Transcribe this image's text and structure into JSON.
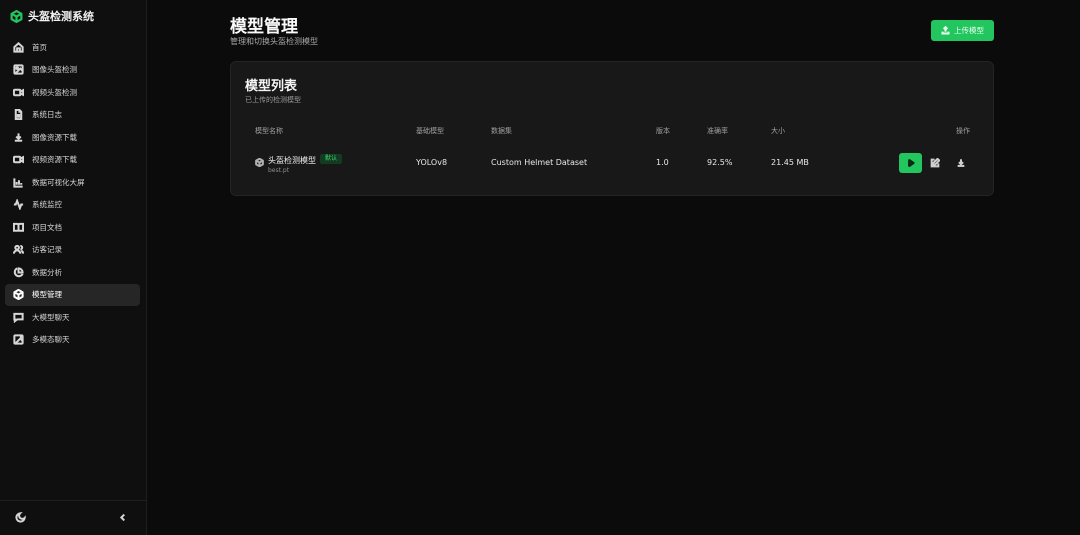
{
  "app": {
    "title": "头盔检测系统",
    "accent_color": "#22c55e"
  },
  "sidebar": {
    "items": [
      {
        "label": "首页",
        "icon": "home-icon"
      },
      {
        "label": "图像头盔检测",
        "icon": "image-icon"
      },
      {
        "label": "视频头盔检测",
        "icon": "video-icon"
      },
      {
        "label": "系统日志",
        "icon": "file-text-icon"
      },
      {
        "label": "图像资源下载",
        "icon": "download-icon"
      },
      {
        "label": "视频资源下载",
        "icon": "video-icon"
      },
      {
        "label": "数据可视化大屏",
        "icon": "bar-chart-icon"
      },
      {
        "label": "系统监控",
        "icon": "activity-icon"
      },
      {
        "label": "项目文档",
        "icon": "book-icon"
      },
      {
        "label": "访客记录",
        "icon": "users-icon"
      },
      {
        "label": "数据分析",
        "icon": "pie-chart-icon"
      },
      {
        "label": "模型管理",
        "icon": "cube-icon",
        "active": true
      },
      {
        "label": "大模型聊天",
        "icon": "message-icon"
      },
      {
        "label": "多模态聊天",
        "icon": "image-plus-icon"
      }
    ]
  },
  "page": {
    "title": "模型管理",
    "subtitle": "管理和切换头盔检测模型",
    "upload_label": "上传模型"
  },
  "model_list": {
    "title": "模型列表",
    "subtitle": "已上传的检测模型",
    "columns": [
      "模型名称",
      "基础模型",
      "数据集",
      "版本",
      "准确率",
      "大小",
      "操作"
    ],
    "rows": [
      {
        "name": "头盔检测模型",
        "badge": "默认",
        "file": "best.pt",
        "base_model": "YOLOv8",
        "dataset": "Custom Helmet Dataset",
        "version": "1.0",
        "accuracy": "92.5%",
        "size": "21.45 MB"
      }
    ]
  }
}
